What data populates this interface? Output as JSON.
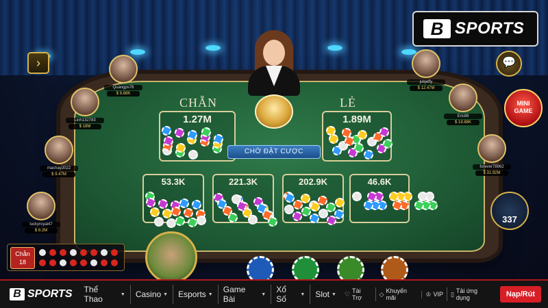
{
  "game": {
    "left_side": {
      "title": "CHẴN",
      "total": "1.27M"
    },
    "right_side": {
      "title": "LẺ",
      "total": "1.89M"
    },
    "status": "CHỜ ĐẶT CƯỢC",
    "sub_bets": [
      "53.3K",
      "221.3K",
      "202.9K",
      "46.6K"
    ],
    "online_count": "337",
    "minigame_label_line1": "MINI",
    "minigame_label_line2": "GAME"
  },
  "players_left": [
    {
      "name": "Quangps76",
      "money": "$ 9.88K"
    },
    {
      "name": "Linh132783",
      "money": "$ 18M"
    },
    {
      "name": "machay2022",
      "money": "$ 9.47M"
    },
    {
      "name": "luckyroyal47",
      "money": "$ 8.2M"
    }
  ],
  "players_right": [
    {
      "name": "jukjeffy",
      "money": "$ 12.47M"
    },
    {
      "name": "Eric88",
      "money": "$ 19.88K"
    },
    {
      "name": "forever78962",
      "money": "$ 31.92M"
    }
  ],
  "history": {
    "label": "Chẵn",
    "count": "18"
  },
  "brand": {
    "logo_letter": "B",
    "logo_text": "SPORTS"
  },
  "nav": {
    "menu": [
      {
        "label": "Thể Thao"
      },
      {
        "label": "Casino"
      },
      {
        "label": "Esports"
      },
      {
        "label": "Game Bài"
      },
      {
        "label": "Xổ Số"
      },
      {
        "label": "Slot"
      }
    ],
    "links": [
      {
        "icon": "sponsor-icon",
        "label": "Tài Trợ"
      },
      {
        "icon": "promo-icon",
        "label": "Khuyến mãi"
      },
      {
        "icon": "vip-icon",
        "label": "VIP"
      },
      {
        "icon": "mobile-icon",
        "label": "Tải ứng dụng"
      }
    ],
    "deposit": "Nạp/Rút"
  },
  "colors": {
    "accent": "#d81f26",
    "felt": "#1f5c36",
    "gold": "#d8b24a"
  }
}
